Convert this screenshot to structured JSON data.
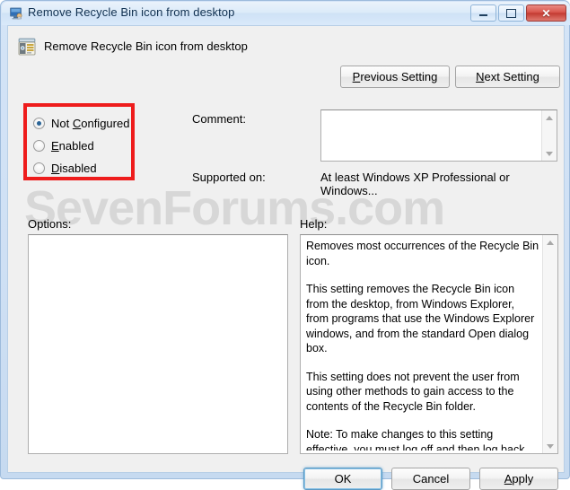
{
  "window": {
    "title": "Remove Recycle Bin icon from desktop",
    "title_icon": "gpedit-monitor-icon",
    "controls": {
      "minimize": "Minimize",
      "restore": "Restore",
      "close": "Close"
    }
  },
  "header": {
    "icon": "policy-setting-icon",
    "title": "Remove Recycle Bin icon from desktop",
    "previous_button": "Previous Setting",
    "previous_accesskey": "P",
    "next_button": "Next Setting",
    "next_accesskey": "N"
  },
  "state": {
    "selected": "not_configured",
    "options": [
      {
        "id": "not_configured",
        "label_pre": "Not ",
        "accesskey": "C",
        "label_post": "onfigured",
        "checked": true
      },
      {
        "id": "enabled",
        "label_pre": "",
        "accesskey": "E",
        "label_post": "nabled",
        "checked": false
      },
      {
        "id": "disabled",
        "label_pre": "",
        "accesskey": "D",
        "label_post": "isabled",
        "checked": false
      }
    ],
    "highlight_color": "#ee1c1c"
  },
  "comment": {
    "label": "Comment:",
    "value": "",
    "placeholder": ""
  },
  "supported": {
    "label": "Supported on:",
    "value": "At least Windows XP Professional or Windows..."
  },
  "options_pane": {
    "label": "Options:",
    "content": ""
  },
  "help_pane": {
    "label": "Help:",
    "paragraphs": [
      "Removes most occurrences of the Recycle Bin icon.",
      "This setting removes the Recycle Bin icon from the desktop, from Windows Explorer, from programs that use the Windows Explorer windows, and from the standard Open dialog box.",
      "This setting does not prevent the user from using other methods to gain access to the contents of the Recycle Bin folder.",
      "Note: To make changes to this setting effective, you must log off and then log back on."
    ]
  },
  "footer": {
    "ok": "OK",
    "cancel": "Cancel",
    "apply_pre": "",
    "apply_accesskey": "A",
    "apply_post": "pply"
  },
  "watermark": {
    "text": "SevenForums.com",
    "color": "#d7d7d7"
  }
}
